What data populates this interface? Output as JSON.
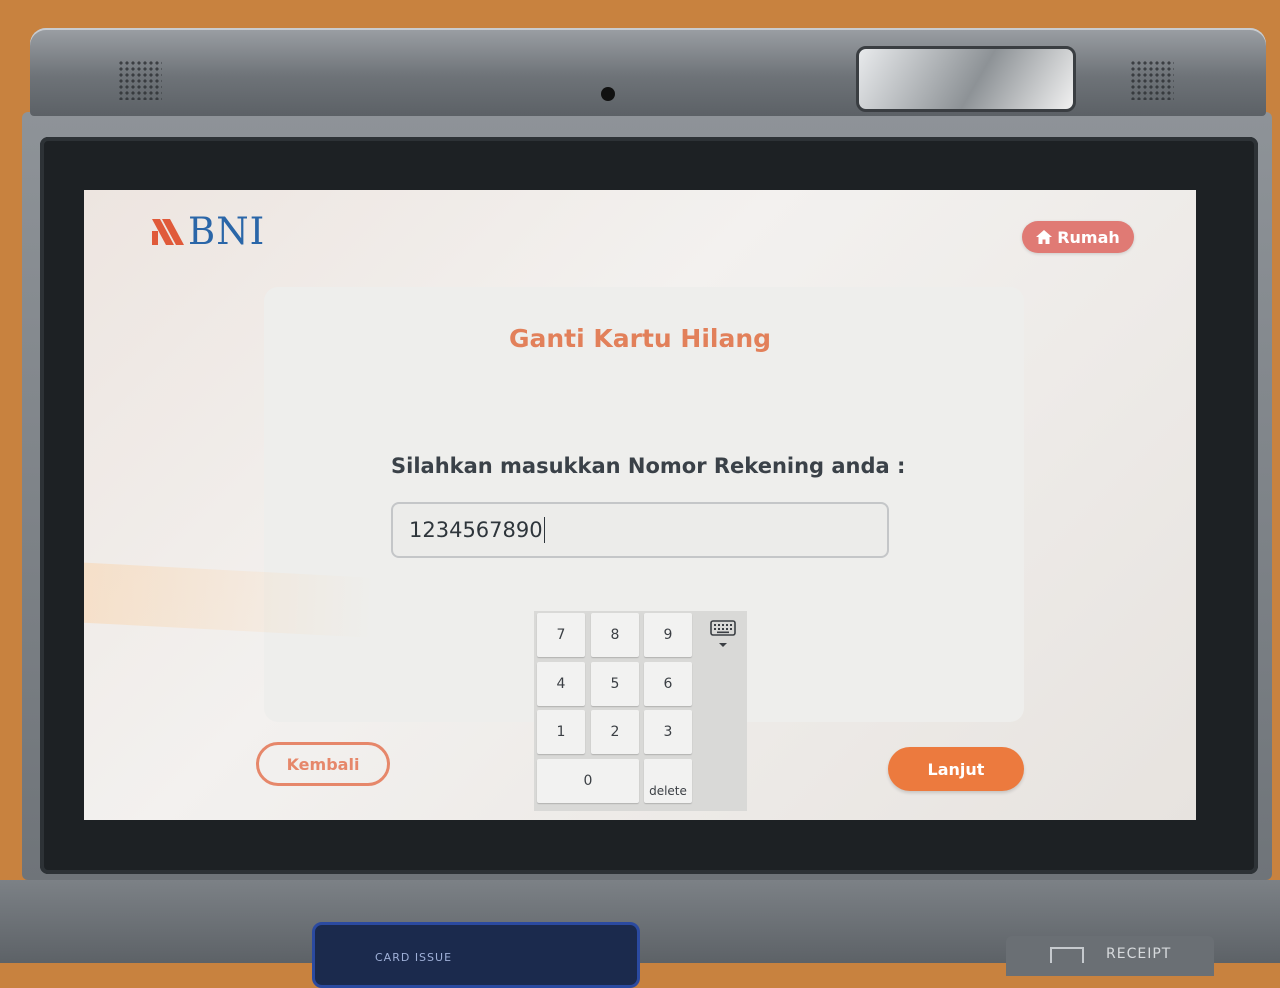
{
  "screen": {
    "brand": "BNI",
    "home_button": "Rumah",
    "title": "Ganti Kartu Hilang",
    "prompt": "Silahkan masukkan Nomor Rekening anda :",
    "account_input_value": "1234567890",
    "keypad": {
      "keys": [
        "7",
        "8",
        "9",
        "4",
        "5",
        "6",
        "1",
        "2",
        "3",
        "0"
      ],
      "delete_label": "delete"
    },
    "back_button": "Kembali",
    "next_button": "Lanjut"
  },
  "hardware": {
    "card_slot_label": "CARD ISSUE",
    "receipt_label": "RECEIPT"
  },
  "colors": {
    "accent_orange": "#ec7a3e",
    "title_orange": "#e2805a",
    "brand_blue": "#2a66a8",
    "brand_red": "#e05a3a",
    "home_pink": "#e07a74"
  }
}
